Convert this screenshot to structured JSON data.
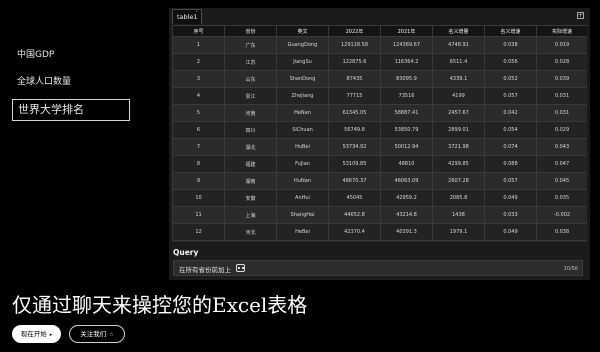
{
  "sidebar": {
    "items": [
      {
        "label": "中国GDP",
        "active": false
      },
      {
        "label": "全球人口数量",
        "active": false
      },
      {
        "label": "世界大学排名",
        "active": true
      }
    ]
  },
  "tabs": [
    {
      "label": "table1"
    }
  ],
  "table": {
    "columns": [
      "序号",
      "省份",
      "英文",
      "2022年",
      "2021年",
      "名义增量",
      "名义增速",
      "实际增速"
    ],
    "rows": [
      [
        "1",
        "广东",
        "GuangDong",
        "129118.58",
        "124369.67",
        "4748.91",
        "0.038",
        "0.019"
      ],
      [
        "2",
        "江苏",
        "JiangSu",
        "122875.6",
        "116364.2",
        "6511.4",
        "0.056",
        "0.028"
      ],
      [
        "3",
        "山东",
        "ShanDong",
        "87435",
        "83095.9",
        "4339.1",
        "0.052",
        "0.039"
      ],
      [
        "4",
        "浙江",
        "ZheJiang",
        "77715",
        "73516",
        "4199",
        "0.057",
        "0.031"
      ],
      [
        "5",
        "河南",
        "HeNan",
        "61345.05",
        "58887.41",
        "2457.67",
        "0.042",
        "0.031"
      ],
      [
        "6",
        "四川",
        "SiChuan",
        "56749.8",
        "53850.79",
        "2899.01",
        "0.054",
        "0.029"
      ],
      [
        "7",
        "湖北",
        "HuBei",
        "53734.92",
        "50012.94",
        "3721.98",
        "0.074",
        "0.043"
      ],
      [
        "8",
        "福建",
        "FuJian",
        "53109.85",
        "48810",
        "4299.85",
        "0.088",
        "0.047"
      ],
      [
        "9",
        "湖南",
        "HuNan",
        "48670.37",
        "46063.09",
        "2607.28",
        "0.057",
        "0.045"
      ],
      [
        "10",
        "安徽",
        "AnHui",
        "45045",
        "42959.2",
        "2085.8",
        "0.049",
        "0.035"
      ],
      [
        "11",
        "上海",
        "ShangHai",
        "44652.8",
        "43214.8",
        "1438",
        "0.033",
        "-0.002"
      ],
      [
        "12",
        "河北",
        "HeBei",
        "42370.4",
        "40391.3",
        "1979.1",
        "0.049",
        "0.038"
      ]
    ]
  },
  "query": {
    "title": "Query",
    "value": "在所有省份前加上",
    "counter": "10/56"
  },
  "headline": "仅通过聊天来操控您的Excel表格",
  "buttons": {
    "start_label": "现在开始",
    "start_icon": "▸",
    "follow_label": "关注我们",
    "follow_icon": "☆"
  }
}
